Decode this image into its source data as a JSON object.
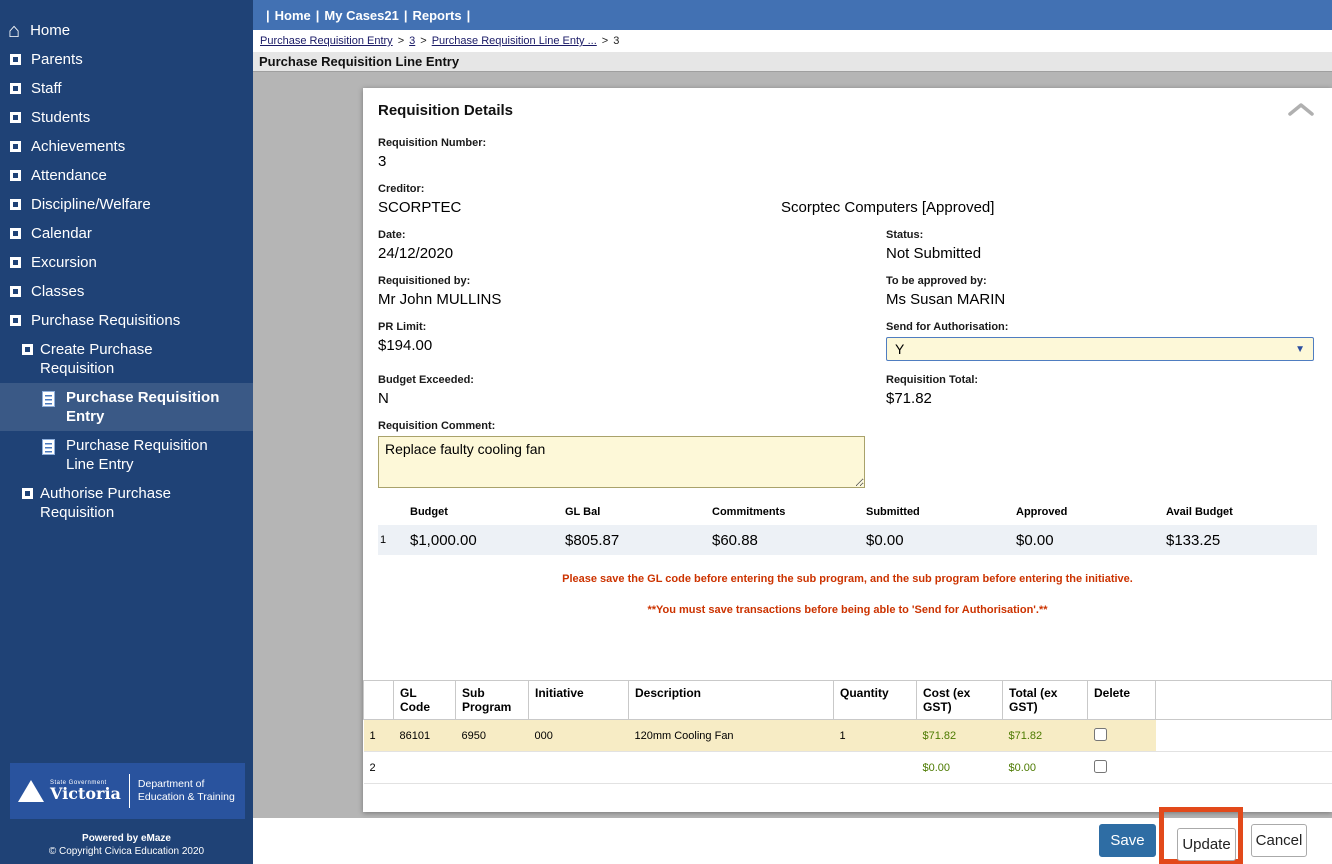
{
  "colors": {
    "sidebar_bg": "#1f4276",
    "topnav_bg": "#4271b3",
    "field_yellow": "#fdf8d8",
    "warning_red": "#cc3300",
    "save_blue": "#2e6da4",
    "annotation_orange": "#e2491a",
    "money_green": "#4c7a00",
    "row_highlight": "#f7ecc5"
  },
  "sidebar": {
    "items": [
      {
        "label": "Home"
      },
      {
        "label": "Parents"
      },
      {
        "label": "Staff"
      },
      {
        "label": "Students"
      },
      {
        "label": "Achievements"
      },
      {
        "label": "Attendance"
      },
      {
        "label": "Discipline/Welfare"
      },
      {
        "label": "Calendar"
      },
      {
        "label": "Excursion"
      },
      {
        "label": "Classes"
      },
      {
        "label": "Purchase Requisitions"
      }
    ],
    "sub_items": [
      {
        "label": "Create Purchase Requisition"
      },
      {
        "label": "Purchase Requisition Entry"
      },
      {
        "label": "Purchase Requisition Line Entry"
      },
      {
        "label": "Authorise Purchase Requisition"
      }
    ],
    "logo": {
      "state": "State Government",
      "victoria": "Victoria",
      "dept_line1": "Department of",
      "dept_line2": "Education & Training"
    },
    "footer": {
      "powered_by": "Powered by eMaze",
      "copyright": "© Copyright Civica Education 2020"
    }
  },
  "top_nav": {
    "separator": "|",
    "items": [
      {
        "label": "Home"
      },
      {
        "label": "My Cases21"
      },
      {
        "label": "Reports"
      }
    ]
  },
  "breadcrumb": {
    "separator": ">",
    "crumbs": [
      {
        "label": "Purchase Requisition Entry"
      },
      {
        "label": "3"
      },
      {
        "label": "Purchase Requisition Line Enty ..."
      },
      {
        "label": "3"
      }
    ]
  },
  "page_title": "Purchase Requisition Line Entry",
  "details": {
    "section_title": "Requisition Details",
    "requisition_number": {
      "label": "Requisition Number:",
      "value": "3"
    },
    "creditor": {
      "label": "Creditor:",
      "value": "SCORPTEC",
      "name": "Scorptec Computers [Approved]"
    },
    "date": {
      "label": "Date:",
      "value": "24/12/2020"
    },
    "status": {
      "label": "Status:",
      "value": "Not Submitted"
    },
    "requisitioned_by": {
      "label": "Requisitioned by:",
      "value": "Mr John MULLINS"
    },
    "approved_by": {
      "label": "To be approved by:",
      "value": "Ms Susan MARIN"
    },
    "pr_limit": {
      "label": "PR Limit:",
      "value": "$194.00"
    },
    "send_for_authorisation": {
      "label": "Send for Authorisation:",
      "value": "Y"
    },
    "budget_exceeded": {
      "label": "Budget Exceeded:",
      "value": "N"
    },
    "requisition_total": {
      "label": "Requisition Total:",
      "value": "$71.82"
    },
    "comment": {
      "label": "Requisition Comment:",
      "value": "Replace faulty cooling fan"
    }
  },
  "budget_summary": {
    "headers": [
      "Budget",
      "GL Bal",
      "Commitments",
      "Submitted",
      "Approved",
      "Avail Budget"
    ],
    "row": {
      "num": "1",
      "budget": "$1,000.00",
      "gl_bal": "$805.87",
      "commitments": "$60.88",
      "submitted": "$0.00",
      "approved": "$0.00",
      "avail_budget": "$133.25"
    }
  },
  "warnings": {
    "line1": "Please save the GL code before entering the sub program, and the sub program before entering the initiative.",
    "line2": "**You must save transactions before being able to 'Send for Authorisation'.**"
  },
  "line_items": {
    "headers": {
      "gl_code": "GL Code",
      "sub_program": "Sub Program",
      "initiative": "Initiative",
      "description": "Description",
      "quantity": "Quantity",
      "cost": "Cost (ex GST)",
      "total": "Total (ex GST)",
      "delete": "Delete"
    },
    "rows": [
      {
        "num": "1",
        "gl_code": "86101",
        "sub_program": "6950",
        "initiative": "000",
        "description": "120mm Cooling Fan",
        "quantity": "1",
        "cost": "$71.82",
        "total": "$71.82"
      },
      {
        "num": "2",
        "gl_code": "",
        "sub_program": "",
        "initiative": "",
        "description": "",
        "quantity": "",
        "cost": "$0.00",
        "total": "$0.00"
      }
    ]
  },
  "footer_buttons": {
    "save": "Save",
    "update": "Update",
    "cancel": "Cancel"
  }
}
